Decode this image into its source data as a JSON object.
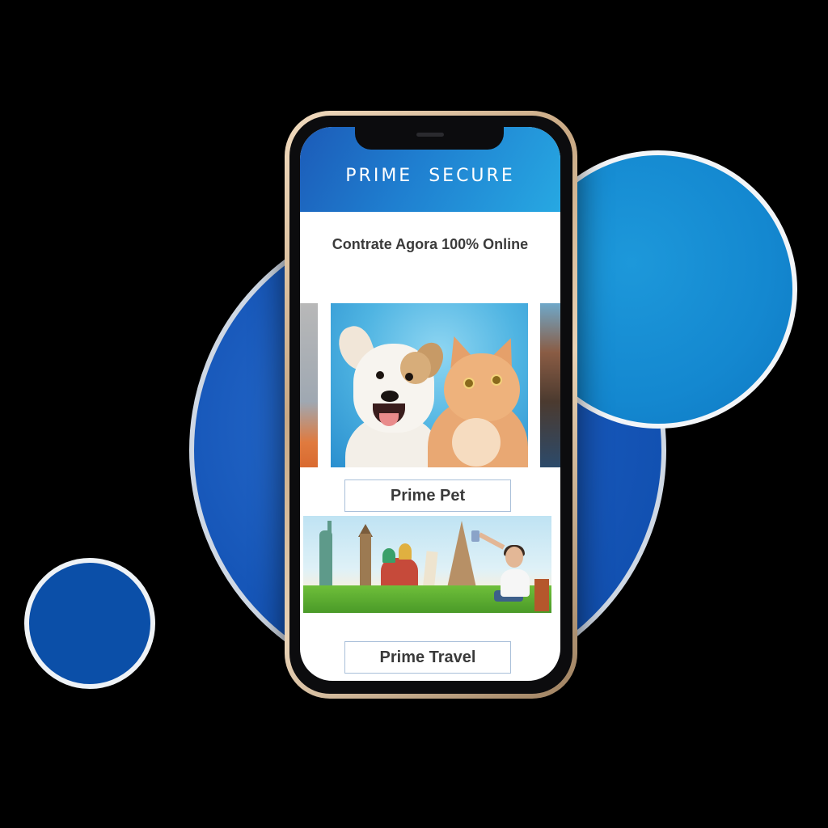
{
  "app": {
    "brand": "PRIME SECURE",
    "tagline": "Contrate Agora 100% Online"
  },
  "products": [
    {
      "label": "Prime Pet",
      "image": "dog-and-cat-photo"
    },
    {
      "label": "Prime Travel",
      "image": "world-landmarks-travel-photo"
    }
  ],
  "colors": {
    "brand_blue": "#1f7fd0",
    "header_gradient_start": "#1c5bb8",
    "header_gradient_end": "#27a8e2",
    "circle_large": "#1656b8",
    "circle_right": "#1488d0",
    "circle_small": "#0b4fa8",
    "background": "#000000"
  }
}
